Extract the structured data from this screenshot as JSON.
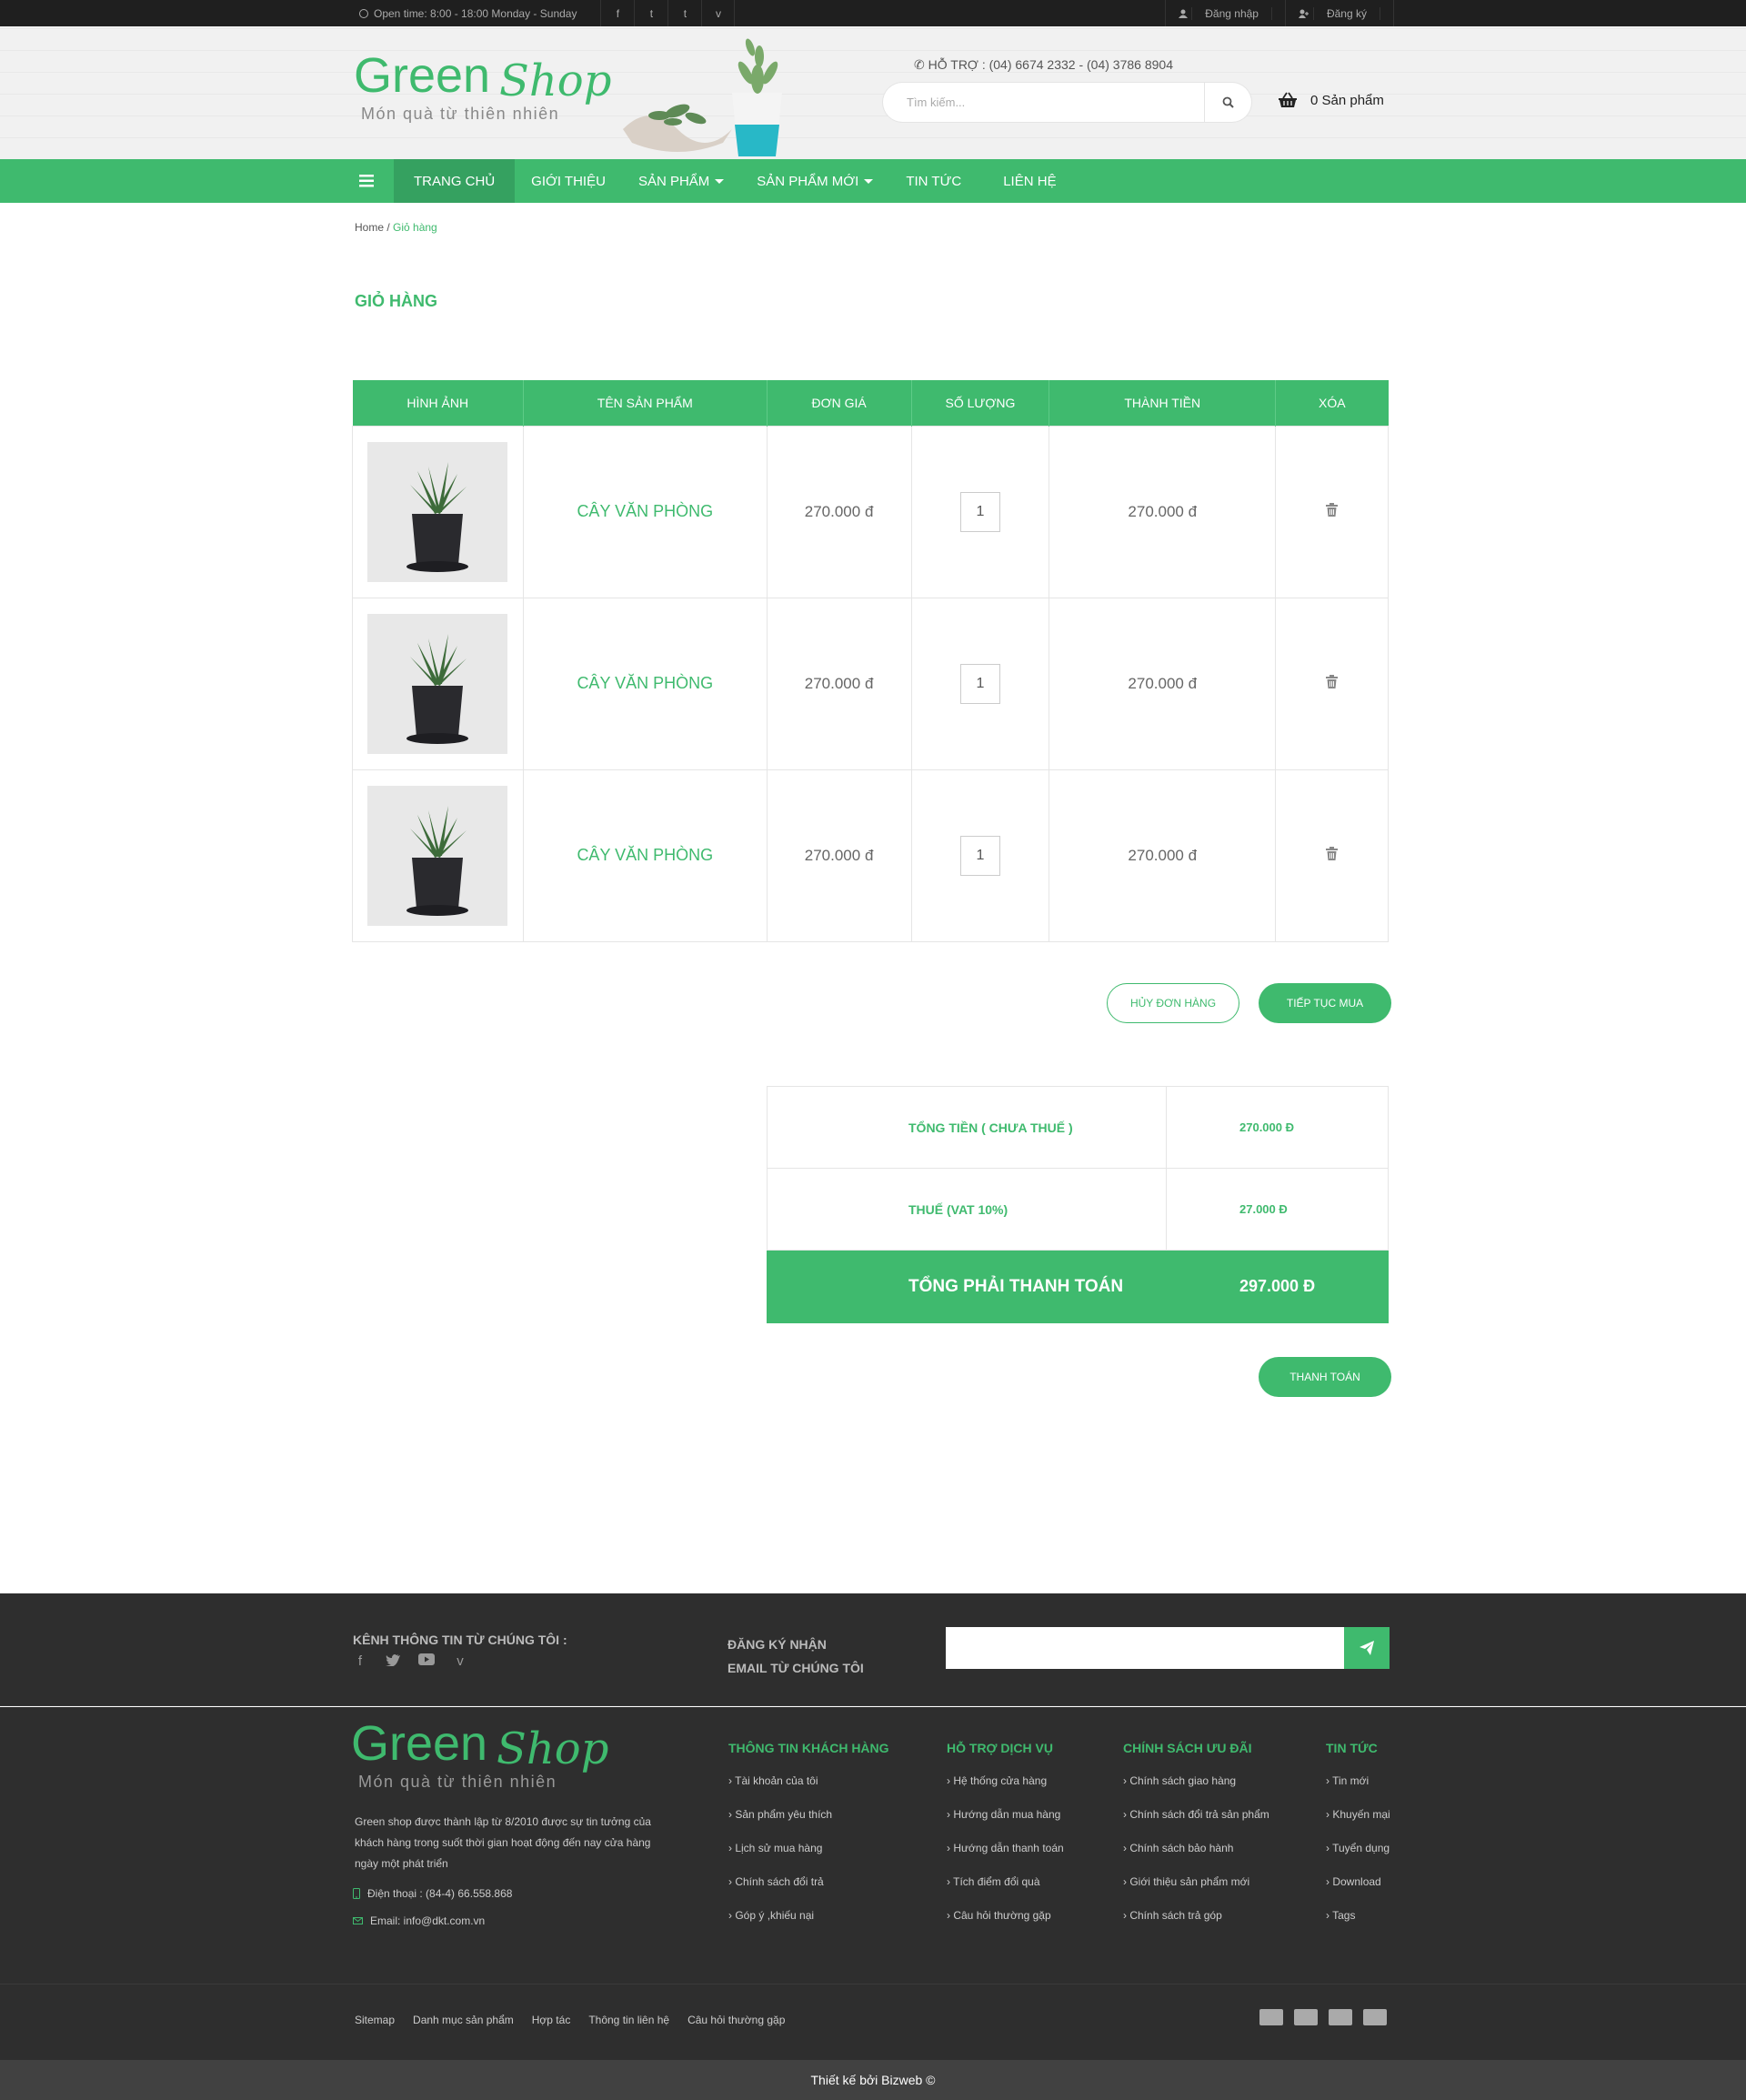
{
  "topbar": {
    "hours": "Open time: 8:00 - 18:00   Monday - Sunday",
    "social": [
      "f",
      "t",
      "t",
      "v"
    ],
    "login": "Đăng nhập",
    "register": "Đăng ký"
  },
  "header": {
    "logo_main": "Green",
    "logo_script": "Shop",
    "logo_tagline": "Món quà từ thiên nhiên",
    "support_label": "HỖ TRỢ :",
    "support_phones": "(04) 6674 2332 - (04) 3786 8904",
    "search_placeholder": "Tìm kiếm...",
    "cart_label": "0 Sản phẩm"
  },
  "nav": {
    "items": [
      {
        "label": "TRANG CHỦ"
      },
      {
        "label": "GIỚI THIỆU"
      },
      {
        "label": "SẢN PHẨM"
      },
      {
        "label": "SẢN PHẨM MỚI"
      },
      {
        "label": "TIN TỨC"
      },
      {
        "label": "LIÊN HỆ"
      }
    ]
  },
  "breadcrumb": {
    "home": "Home",
    "sep": " / ",
    "current": "Giỏ hàng"
  },
  "page_title": "GIỎ HÀNG",
  "cart_table": {
    "headers": [
      "HÌNH ẢNH",
      "TÊN SẢN PHẨM",
      "ĐƠN GIÁ",
      "SỐ LƯỢNG",
      "THÀNH TIỀN",
      "XÓA"
    ],
    "rows": [
      {
        "name": "CÂY VĂN PHÒNG",
        "price": "270.000 đ",
        "qty": "1",
        "total": "270.000 đ"
      },
      {
        "name": "CÂY VĂN PHÒNG",
        "price": "270.000 đ",
        "qty": "1",
        "total": "270.000 đ"
      },
      {
        "name": "CÂY VĂN PHÒNG",
        "price": "270.000 đ",
        "qty": "1",
        "total": "270.000 đ"
      }
    ]
  },
  "buttons": {
    "cancel": "HỦY ĐƠN HÀNG",
    "continue": "TIẾP TỤC MUA",
    "checkout": "THANH TOÁN"
  },
  "totals": {
    "subtotal_label": "TỔNG TIỀN  ( CHƯA THUẾ )",
    "subtotal_value": "270.000 đ",
    "tax_label": "THUẾ  (VAT 10%)",
    "tax_value": "27.000 đ",
    "grand_label": "TỔNG PHẢI THANH TOÁN",
    "grand_value": "297.000 đ"
  },
  "footer": {
    "channel_label": "KÊNH THÔNG TIN TỪ CHÚNG TÔI :",
    "subscribe_line1": "ĐĂNG KÝ NHẬN",
    "subscribe_line2": "EMAIL TỪ CHÚNG TÔI",
    "about": "Green shop được thành lập từ 8/2010 được sự tin tưởng của khách hàng trong suốt thời gian hoạt động đến nay cửa hàng ngày một phát triển",
    "phone": "Điện thoại : (84-4) 66.558.868",
    "email": "Email: info@dkt.com.vn",
    "columns": [
      {
        "title": "THÔNG TIN KHÁCH HÀNG",
        "items": [
          "Tài khoản của tôi",
          "Sản phẩm yêu thích",
          "Lịch sử mua hàng",
          "Chính sách đổi trả",
          "Góp ý ,khiếu nại"
        ]
      },
      {
        "title": "HỖ TRỢ DỊCH VỤ",
        "items": [
          "Hệ thống cửa hàng",
          "Hướng dẫn mua hàng",
          "Hướng dẫn thanh toán",
          "Tích điểm đổi quà",
          "Câu hỏi thường gặp"
        ]
      },
      {
        "title": "CHÍNH SÁCH ƯU ĐÃI",
        "items": [
          "Chính sách giao hàng",
          "Chính sách đổi trả sản phẩm",
          "Chính sách bảo hành",
          "Giới thiệu sản phẩm mới",
          "Chính sách trả góp"
        ]
      },
      {
        "title": "TIN TỨC",
        "items": [
          "Tin mới",
          "Khuyến mại",
          "Tuyển dụng",
          "Download",
          "Tags"
        ]
      }
    ],
    "bottom_links": [
      "Sitemap",
      "Danh mục sản phẩm",
      "Hợp tác",
      "Thông tin liên hệ",
      "Câu hỏi thường gặp"
    ],
    "payment_icons": [
      "visa-icon",
      "mastercard-icon",
      "paypal-icon",
      "amex-icon"
    ],
    "copyright": "Thiết kế  bởi Bizweb ©"
  },
  "colors": {
    "accent": "#3fba6e",
    "dark": "#2e2e2e",
    "topbar": "#1f1f1f"
  }
}
